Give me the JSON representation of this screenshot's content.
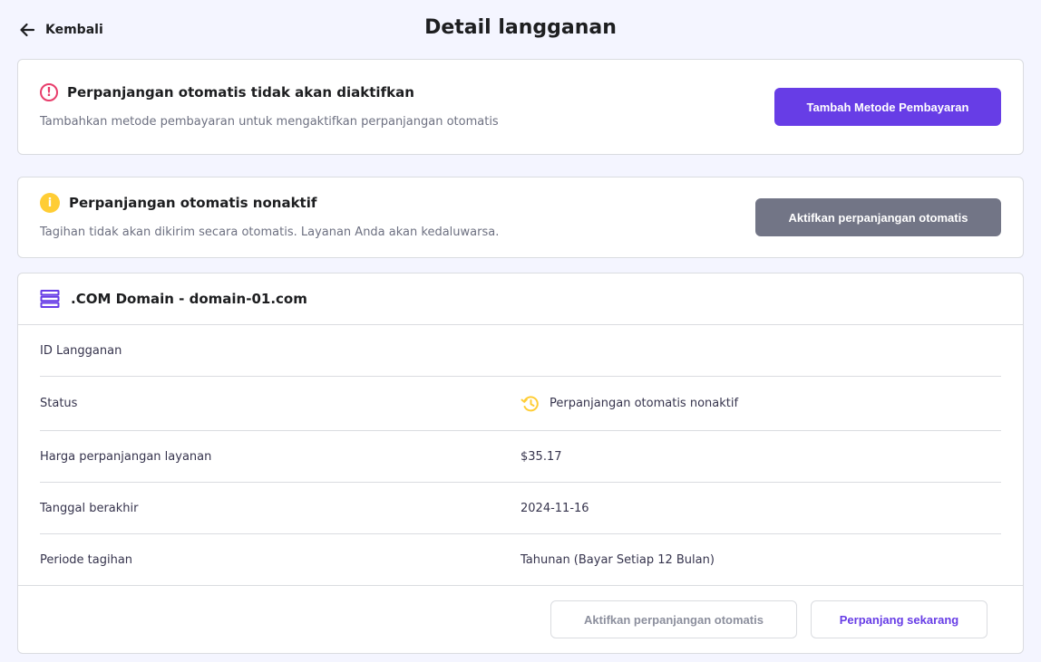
{
  "header": {
    "back_label": "Kembali",
    "title": "Detail langganan"
  },
  "alert_payment": {
    "icon": "exclamation-circle-icon",
    "title": "Perpanjangan otomatis tidak akan diaktifkan",
    "description": "Tambahkan metode pembayaran untuk mengaktifkan perpanjangan otomatis",
    "button_label": "Tambah Metode Pembayaran"
  },
  "alert_autorenew": {
    "icon": "info-circle-icon",
    "title": "Perpanjangan otomatis nonaktif",
    "description": "Tagihan tidak akan dikirim secara otomatis. Layanan Anda akan kedaluwarsa.",
    "button_label": "Aktifkan perpanjangan otomatis"
  },
  "subscription": {
    "icon": "server-icon",
    "title": ".COM Domain - domain-01.com",
    "rows": [
      {
        "label": "ID Langganan",
        "value": ""
      },
      {
        "label": "Status",
        "value": "Perpanjangan otomatis nonaktif"
      },
      {
        "label": "Harga perpanjangan layanan",
        "value": "$35.17"
      },
      {
        "label": "Tanggal berakhir",
        "value": "2024-11-16"
      },
      {
        "label": "Periode tagihan",
        "value": "Tahunan (Bayar Setiap 12 Bulan)"
      }
    ],
    "footer": {
      "enable_autorenew_label": "Aktifkan perpanjangan otomatis",
      "renew_now_label": "Perpanjang sekarang"
    }
  },
  "colors": {
    "primary": "#673de6",
    "danger": "#e83d6b",
    "warning": "#ffcd35",
    "gray_button": "#727586",
    "background": "#f4f5ff"
  }
}
